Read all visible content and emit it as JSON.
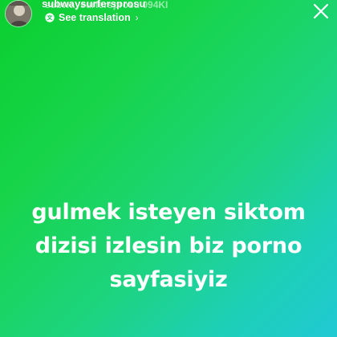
{
  "header": {
    "username": "subwaysurfersprosu",
    "username_overlay": "subwaysurfersprosu 094KI",
    "translation_label": "See translation",
    "chevron": "›"
  },
  "story": {
    "lines": [
      "gulmek isteyen siktom",
      "dizisi izlesin biz porno",
      "sayfasiyiz"
    ],
    "background_start": "#0bcf2f",
    "background_end": "#21c9d3",
    "text_color": "#ffffff"
  },
  "icons": {
    "avatar": "profile-avatar",
    "translate": "translate-icon",
    "close": "close-icon"
  }
}
